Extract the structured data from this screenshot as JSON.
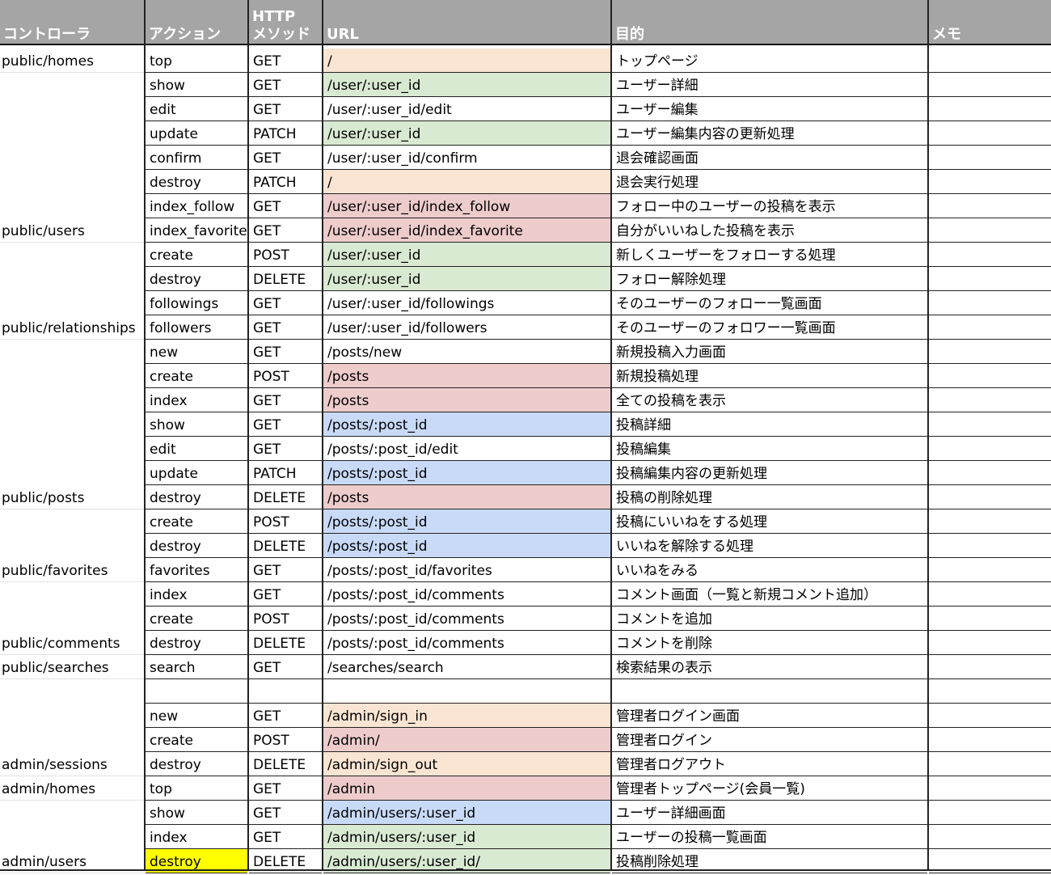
{
  "headers": {
    "controller": "コントローラ",
    "action": "アクション",
    "method_line1": "HTTP",
    "method_line2": "メソッド",
    "url": "URL",
    "purpose": "目的",
    "memo": "メモ"
  },
  "colors": {
    "header_bg": "#a5a5a5",
    "peach": "#fae5d3",
    "green": "#d9ead3",
    "pink": "#eecccc",
    "blue": "#c9daf8",
    "yellow": "#ffff00"
  },
  "rows": [
    {
      "controller": "public/homes",
      "action": "top",
      "method": "GET",
      "url": "/",
      "url_color": "peach",
      "purpose": "トップページ",
      "memo": ""
    },
    {
      "controller": "",
      "action": "show",
      "method": "GET",
      "url": "/user/:user_id",
      "url_color": "green",
      "purpose": "ユーザー詳細",
      "memo": ""
    },
    {
      "controller": "",
      "action": "edit",
      "method": "GET",
      "url": "/user/:user_id/edit",
      "url_color": "",
      "purpose": "ユーザー編集",
      "memo": ""
    },
    {
      "controller": "",
      "action": "update",
      "method": "PATCH",
      "url": "/user/:user_id",
      "url_color": "green",
      "purpose": "ユーザー編集内容の更新処理",
      "memo": ""
    },
    {
      "controller": "",
      "action": "confirm",
      "method": "GET",
      "url": "/user/:user_id/confirm",
      "url_color": "",
      "purpose": "退会確認画面",
      "memo": ""
    },
    {
      "controller": "",
      "action": "destroy",
      "method": "PATCH",
      "url": "/",
      "url_color": "peach",
      "purpose": "退会実行処理",
      "memo": ""
    },
    {
      "controller": "",
      "action": "index_follow",
      "method": "GET",
      "url": "/user/:user_id/index_follow",
      "url_color": "pink",
      "purpose": "フォロー中のユーザーの投稿を表示",
      "memo": ""
    },
    {
      "controller": "public/users",
      "action": "index_favorite",
      "method": "GET",
      "url": "/user/:user_id/index_favorite",
      "url_color": "pink",
      "purpose": "自分がいいねした投稿を表示",
      "memo": ""
    },
    {
      "controller": "",
      "action": "create",
      "method": "POST",
      "url": "/user/:user_id",
      "url_color": "green",
      "purpose": "新しくユーザーをフォローする処理",
      "memo": ""
    },
    {
      "controller": "",
      "action": "destroy",
      "method": "DELETE",
      "url": "/user/:user_id",
      "url_color": "green",
      "purpose": "フォロー解除処理",
      "memo": ""
    },
    {
      "controller": "",
      "action": "followings",
      "method": "GET",
      "url": "/user/:user_id/followings",
      "url_color": "",
      "purpose": "そのユーザーのフォロー一覧画面",
      "memo": ""
    },
    {
      "controller": "public/relationships",
      "action": "followers",
      "method": "GET",
      "url": "/user/:user_id/followers",
      "url_color": "",
      "purpose": "そのユーザーのフォロワー一覧画面",
      "memo": ""
    },
    {
      "controller": "",
      "action": "new",
      "method": "GET",
      "url": "/posts/new",
      "url_color": "",
      "purpose": "新規投稿入力画面",
      "memo": ""
    },
    {
      "controller": "",
      "action": "create",
      "method": "POST",
      "url": "/posts",
      "url_color": "pink",
      "purpose": "新規投稿処理",
      "memo": ""
    },
    {
      "controller": "",
      "action": "index",
      "method": "GET",
      "url": "/posts",
      "url_color": "pink",
      "purpose": "全ての投稿を表示",
      "memo": ""
    },
    {
      "controller": "",
      "action": "show",
      "method": "GET",
      "url": "/posts/:post_id",
      "url_color": "blue",
      "purpose": "投稿詳細",
      "memo": ""
    },
    {
      "controller": "",
      "action": "edit",
      "method": "GET",
      "url": "/posts/:post_id/edit",
      "url_color": "",
      "purpose": "投稿編集",
      "memo": ""
    },
    {
      "controller": "",
      "action": "update",
      "method": "PATCH",
      "url": "/posts/:post_id",
      "url_color": "blue",
      "purpose": "投稿編集内容の更新処理",
      "memo": ""
    },
    {
      "controller": "public/posts",
      "action": "destroy",
      "method": "DELETE",
      "url": "/posts",
      "url_color": "pink",
      "purpose": "投稿の削除処理",
      "memo": ""
    },
    {
      "controller": "",
      "action": "create",
      "method": "POST",
      "url": "/posts/:post_id",
      "url_color": "blue",
      "purpose": "投稿にいいねをする処理",
      "memo": ""
    },
    {
      "controller": "",
      "action": "destroy",
      "method": "DELETE",
      "url": "/posts/:post_id",
      "url_color": "blue",
      "purpose": "いいねを解除する処理",
      "memo": ""
    },
    {
      "controller": "public/favorites",
      "action": "favorites",
      "method": "GET",
      "url": "/posts/:post_id/favorites",
      "url_color": "",
      "purpose": "いいねをみる",
      "memo": ""
    },
    {
      "controller": "",
      "action": "index",
      "method": "GET",
      "url": "/posts/:post_id/comments",
      "url_color": "",
      "purpose": "コメント画面（一覧と新規コメント追加）",
      "memo": ""
    },
    {
      "controller": "",
      "action": "create",
      "method": "POST",
      "url": "/posts/:post_id/comments",
      "url_color": "",
      "purpose": "コメントを追加",
      "memo": ""
    },
    {
      "controller": "public/comments",
      "action": "destroy",
      "method": "DELETE",
      "url": "/posts/:post_id/comments",
      "url_color": "",
      "purpose": "コメントを削除",
      "memo": ""
    },
    {
      "controller": "public/searches",
      "action": "search",
      "method": "GET",
      "url": "/searches/search",
      "url_color": "",
      "purpose": "検索結果の表示",
      "memo": ""
    },
    {
      "controller": "",
      "action": "",
      "method": "",
      "url": "",
      "url_color": "",
      "purpose": "",
      "memo": ""
    },
    {
      "controller": "",
      "action": "new",
      "method": "GET",
      "url": "/admin/sign_in",
      "url_color": "peach",
      "purpose": "管理者ログイン画面",
      "memo": ""
    },
    {
      "controller": "",
      "action": "create",
      "method": "POST",
      "url": "/admin/",
      "url_color": "pink",
      "purpose": "管理者ログイン",
      "memo": ""
    },
    {
      "controller": "admin/sessions",
      "action": "destroy",
      "method": "DELETE",
      "url": "/admin/sign_out",
      "url_color": "peach",
      "purpose": "管理者ログアウト",
      "memo": ""
    },
    {
      "controller": "admin/homes",
      "action": "top",
      "method": "GET",
      "url": "/admin",
      "url_color": "pink",
      "purpose": "管理者トップページ(会員一覧)",
      "memo": ""
    },
    {
      "controller": "",
      "action": "show",
      "method": "GET",
      "url": "/admin/users/:user_id",
      "url_color": "blue",
      "purpose": "ユーザー詳細画面",
      "memo": ""
    },
    {
      "controller": "",
      "action": "index",
      "method": "GET",
      "url": "/admin/users/:user_id",
      "url_color": "green",
      "purpose": "ユーザーの投稿一覧画面",
      "memo": ""
    },
    {
      "controller": "admin/users",
      "action": "destroy",
      "action_color": "yellow",
      "method": "DELETE",
      "url": "/admin/users/:user_id/",
      "url_color": "green",
      "purpose": "投稿削除処理",
      "memo": ""
    }
  ]
}
